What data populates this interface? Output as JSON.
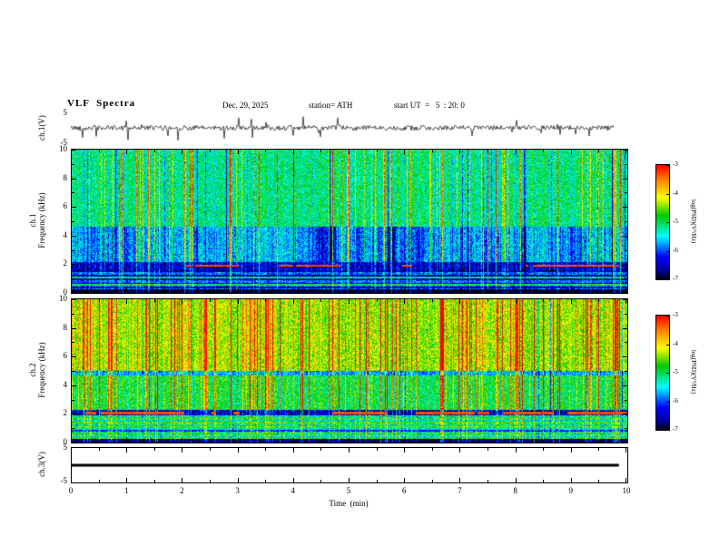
{
  "figure": {
    "title": "VLF  Spectra",
    "date": "Dec. 29, 2025",
    "station": "station= ATH",
    "start_ut": "start UT  =   5  : 20: 0"
  },
  "axes": {
    "time_label": "Time  (min)",
    "time_ticks": [
      "0",
      "1",
      "2",
      "3",
      "4",
      "5",
      "6",
      "7",
      "8",
      "9",
      "10"
    ],
    "freq_ticks": [
      "0",
      "2",
      "4",
      "6",
      "8",
      "10"
    ],
    "volt_ticks": [
      "5",
      "-5"
    ],
    "ch1_wave_label": "ch.1(V)",
    "ch1_label": "ch.1",
    "ch2_label": "ch.2",
    "freq_label": "Frequency  (kHz)",
    "ch3_label": "ch.3(V)"
  },
  "colorbar": {
    "label": "log(PSD)(V²/Hz)",
    "ticks": [
      "-3",
      "-4",
      "-5",
      "-6",
      "-7"
    ],
    "colormap": [
      [
        0,
        "#000000"
      ],
      [
        0.07,
        "#00008b"
      ],
      [
        0.2,
        "#0000ff"
      ],
      [
        0.38,
        "#00ffff"
      ],
      [
        0.56,
        "#00c800"
      ],
      [
        0.72,
        "#ffff00"
      ],
      [
        0.86,
        "#ff8c00"
      ],
      [
        1,
        "#ff0000"
      ]
    ]
  },
  "chart_data": [
    {
      "type": "line",
      "panel": "ch1-waveform",
      "ylabel": "ch.1(V)",
      "xlabel": "Time (min)",
      "ylim": [
        -5,
        5
      ],
      "xlim": [
        0,
        10
      ],
      "yticks": [
        5,
        -5
      ],
      "description": "Dense noisy black trace centered on 0 V, typical amplitude about ±1.5 V with frequent spikes reaching about ±4 V; trace ends near 9.8 min."
    },
    {
      "type": "heatmap",
      "panel": "ch1-spectrogram",
      "ylabel": "Frequency (kHz)",
      "xlabel": "Time (min)",
      "ylim": [
        0,
        10
      ],
      "xlim": [
        0,
        10
      ],
      "yticks": [
        0,
        2,
        4,
        6,
        8,
        10
      ],
      "zlabel": "log(PSD)(V²/Hz)",
      "zlim": [
        -7,
        -3
      ],
      "bands": [
        {
          "f": [
            0,
            0.25
          ],
          "level": -7
        },
        {
          "f": [
            0.25,
            1.6
          ],
          "level": -6.3,
          "stripes": true,
          "lines": [
            {
              "f": 0.55,
              "level": -5.0
            },
            {
              "f": 1.1,
              "level": -5.3
            }
          ]
        },
        {
          "f": [
            1.6,
            2.15
          ],
          "level": -6.4,
          "red_line_f": 1.9
        },
        {
          "f": [
            2.15,
            4.6
          ],
          "level": -5.6,
          "blue_patches": true
        },
        {
          "f": [
            4.6,
            10
          ],
          "level": -5.1
        }
      ],
      "streaks": {
        "prob": 0.16,
        "min": 0.5,
        "max": 2.0,
        "neg_prob": 0.3,
        "low_f_factor": 0.45
      },
      "description": "Mottled green/cyan background (~-5 level) with dense vertical yellow-to-red sferic streaks; dark blue/black horizontal banding below 2 kHz; black strip near 0 kHz; intermittent dark-red line segments near 1.9 kHz; blue low-power patches between ~2.5 and 4.5 kHz."
    },
    {
      "type": "heatmap",
      "panel": "ch2-spectrogram",
      "ylabel": "Frequency (kHz)",
      "xlabel": "Time (min)",
      "ylim": [
        0,
        10
      ],
      "xlim": [
        0,
        10
      ],
      "yticks": [
        0,
        2,
        4,
        6,
        8,
        10
      ],
      "zlabel": "log(PSD)(V²/Hz)",
      "zlim": [
        -7,
        -3
      ],
      "bands": [
        {
          "f": [
            0,
            0.25
          ],
          "level": -6.8
        },
        {
          "f": [
            0.25,
            1.9
          ],
          "level": -5.2,
          "stripes": true,
          "lines": [
            {
              "f": 0.8,
              "level": -6.2
            }
          ]
        },
        {
          "f": [
            1.9,
            2.3
          ],
          "level": -6.5,
          "red_line_f": 2.05
        },
        {
          "f": [
            2.3,
            4.7
          ],
          "level": -4.9
        },
        {
          "f": [
            4.7,
            5.0
          ],
          "level": -5.7
        },
        {
          "f": [
            5.0,
            10
          ],
          "level": -4.35
        }
      ],
      "streaks": {
        "prob": 0.2,
        "min": 0.6,
        "max": 2.2,
        "neg_prob": 0.05,
        "low_f_factor": 0.5
      },
      "description": "Yellow/green upper half (5-10 kHz) crossed by many red vertical sferic streaks; green mid band 2.3-4.7 kHz; dark band near 2 kHz with intermittent red segments; green/cyan horizontal striping below 2 kHz; dark strip near 0 kHz."
    },
    {
      "type": "line",
      "panel": "ch3-waveform",
      "ylabel": "ch.3(V)",
      "xlabel": "Time (min)",
      "ylim": [
        -5,
        5
      ],
      "xlim": [
        0,
        10
      ],
      "yticks": [
        5,
        -5
      ],
      "description": "Flat thick black line at 0 V (no signal), extending to about 9.8 min."
    }
  ]
}
